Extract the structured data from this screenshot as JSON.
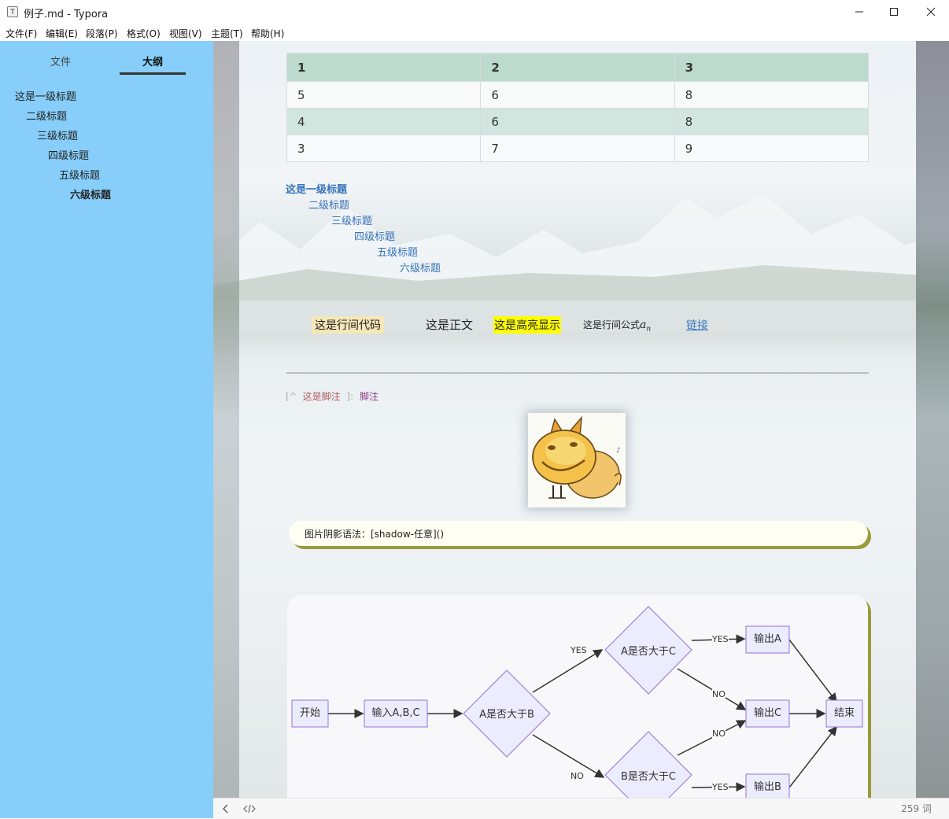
{
  "window": {
    "title": "例子.md - Typora",
    "app_icon": "T"
  },
  "menu": [
    "文件(F)",
    "编辑(E)",
    "段落(P)",
    "格式(O)",
    "视图(V)",
    "主题(T)",
    "帮助(H)"
  ],
  "sidebar": {
    "tabs": [
      "文件",
      "大纲"
    ],
    "active_tab": "大纲",
    "outline": [
      "这是一级标题",
      "二级标题",
      "三级标题",
      "四级标题",
      "五级标题",
      "六级标题"
    ],
    "background": "#87cefa"
  },
  "table": {
    "headers": [
      "1",
      "2",
      "3"
    ],
    "rows": [
      [
        "5",
        "6",
        "8"
      ],
      [
        "4",
        "6",
        "8"
      ],
      [
        "3",
        "7",
        "9"
      ]
    ]
  },
  "toc": [
    "这是一级标题",
    "二级标题",
    "三级标题",
    "四级标题",
    "五级标题",
    "六级标题"
  ],
  "inline": {
    "code": "这是行间代码",
    "body": "这是正文",
    "highlight": "这是高亮显示",
    "math_prefix": "这是行间公式",
    "math_var": "a",
    "math_sub": "n",
    "link": "链接"
  },
  "footnote": {
    "open": "[^",
    "text": "这是脚注",
    "close": "]:",
    "label": "脚注"
  },
  "blockquote": "图片阴影语法：[shadow-任意]()",
  "flowchart": {
    "nodes": {
      "start": "开始",
      "input": "输入A,B,C",
      "ab": "A是否大于B",
      "ac": "A是否大于C",
      "bc": "B是否大于C",
      "outA": "输出A",
      "outC": "输出C",
      "outB": "输出B",
      "end": "结束"
    },
    "yes": "YES",
    "no": "NO"
  },
  "status": {
    "word_count": "259 词"
  }
}
